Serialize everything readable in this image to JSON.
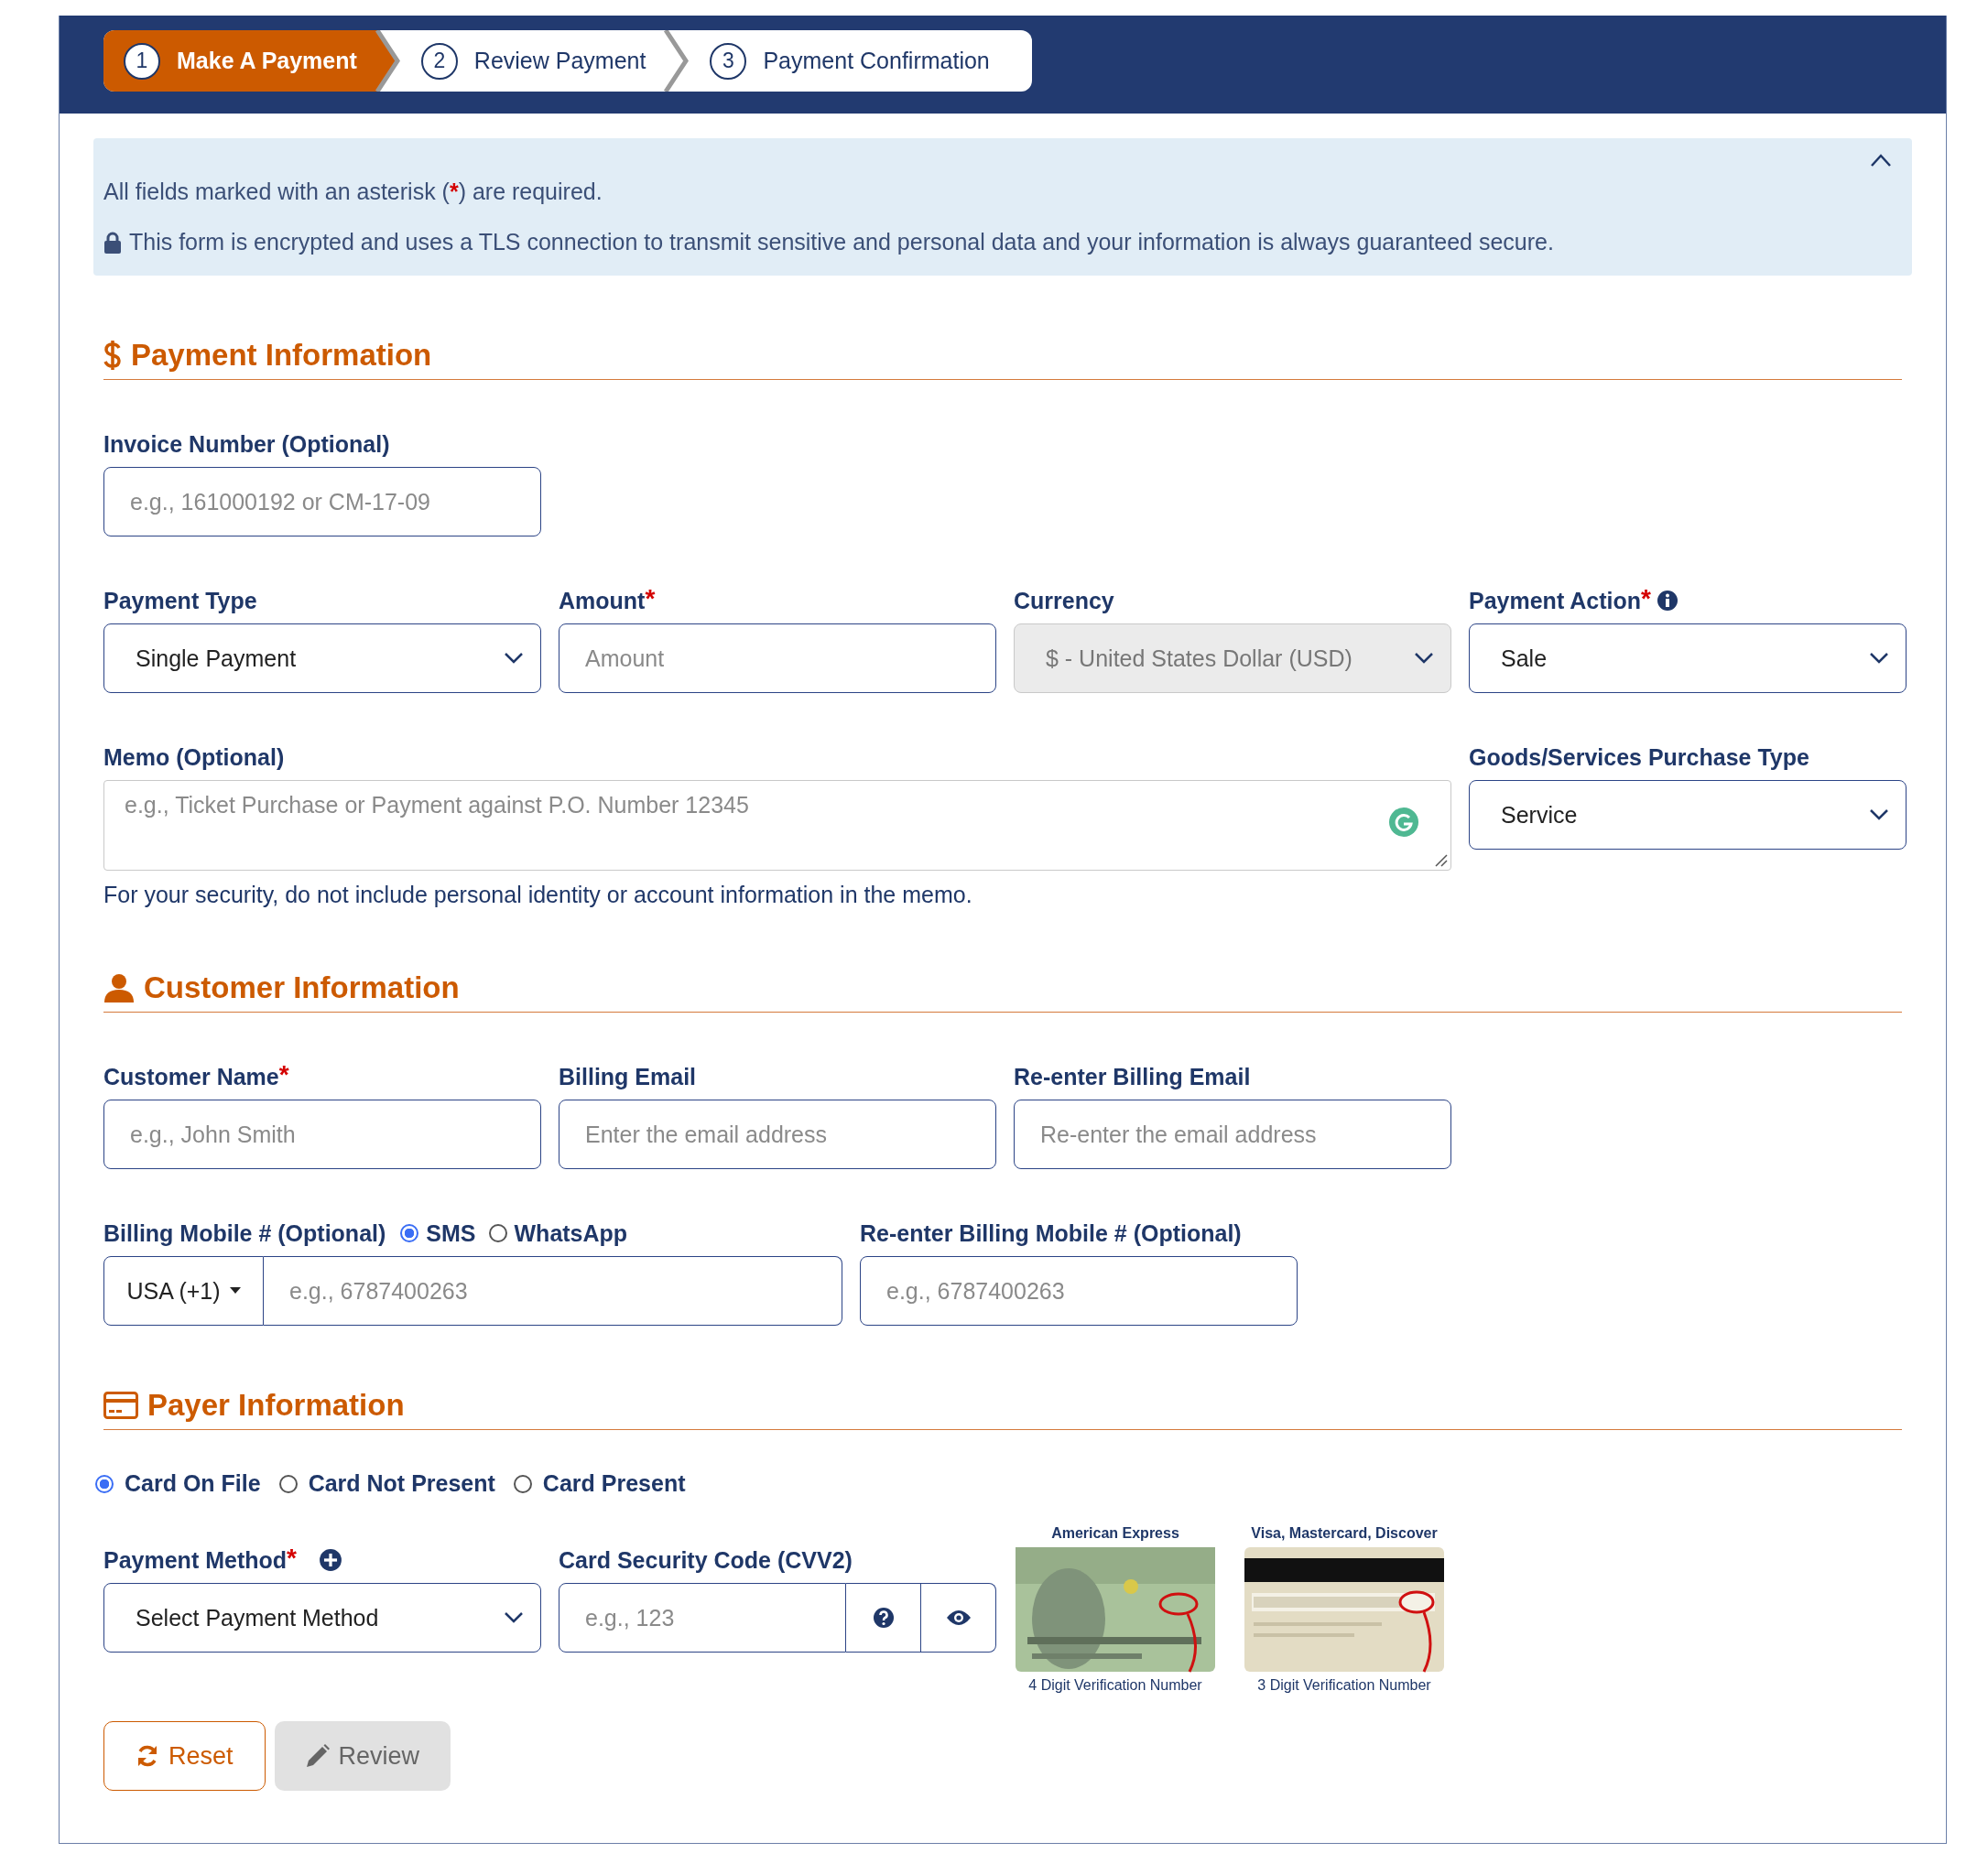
{
  "steps": [
    {
      "number": "1",
      "label": "Make A Payment",
      "selected": true
    },
    {
      "number": "2",
      "label": "Review Payment",
      "selected": false
    },
    {
      "number": "3",
      "label": "Payment Confirmation",
      "selected": false
    }
  ],
  "notice": {
    "expanded": true,
    "required_note": {
      "before": "All fields marked with an asterisk (",
      "mark": "*",
      "after": ") are required."
    },
    "security_note": "This form is encrypted and uses a TLS connection to transmit sensitive and personal data and your information is always guaranteed secure."
  },
  "sections": [
    {
      "kind": "payment",
      "title": "Payment Information",
      "rows": [
        [
          {
            "kind": "text",
            "label": "Invoice Number (Optional)",
            "required": false,
            "placeholder": "e.g., 161000192 or CM-17-09"
          }
        ],
        [
          {
            "kind": "select",
            "label": "Payment Type",
            "required": false,
            "value": "Single Payment",
            "disabled": false
          },
          {
            "kind": "text",
            "label": "Amount",
            "required": true,
            "placeholder": "Amount"
          },
          {
            "kind": "select",
            "label": "Currency",
            "required": false,
            "value": "$ - United States Dollar (USD)",
            "disabled": true
          },
          {
            "kind": "select",
            "label": "Payment Action",
            "required": true,
            "info": true,
            "value": "Sale",
            "disabled": false
          }
        ],
        [
          {
            "kind": "textarea",
            "label": "Memo (Optional)",
            "required": false,
            "placeholder": "e.g., Ticket Purchase or Payment against P.O. Number 12345",
            "hint": "For your security, do not include personal identity or account information in the memo."
          },
          "",
          "",
          {
            "kind": "select",
            "label": "Goods/Services Purchase Type",
            "required": false,
            "value": "Service",
            "disabled": false
          }
        ]
      ]
    },
    {
      "kind": "customer",
      "title": "Customer Information",
      "rows": [
        [
          {
            "kind": "text",
            "label": "Customer Name",
            "required": true,
            "placeholder": "e.g., John Smith"
          },
          {
            "kind": "text",
            "label": "Billing Email",
            "required": false,
            "placeholder": "Enter the email address"
          },
          {
            "kind": "text",
            "label": "Re-enter Billing Email",
            "required": false,
            "placeholder": "Re-enter the email address"
          }
        ],
        [
          {
            "kind": "phone",
            "label": "Billing Mobile # (Optional)",
            "required": false,
            "radios": [
              {
                "label": "SMS",
                "selected": true
              },
              {
                "label": "WhatsApp",
                "selected": false
              }
            ],
            "country": "USA (+1)",
            "placeholder": "e.g., 6787400263"
          },
          "",
          {
            "kind": "text",
            "label": "Re-enter Billing Mobile # (Optional)",
            "required": false,
            "placeholder": "e.g., 6787400263"
          }
        ]
      ]
    },
    {
      "kind": "payer",
      "title": "Payer Information",
      "radios": [
        {
          "label": "Card On File",
          "selected": true
        },
        {
          "label": "Card Not Present",
          "selected": false
        },
        {
          "label": "Card Present",
          "selected": false
        }
      ],
      "rows": [
        [
          {
            "kind": "select",
            "label": "Payment Method",
            "required": true,
            "add": true,
            "value": "Select Payment Method",
            "disabled": false
          },
          {
            "kind": "cvv",
            "label": "Card Security Code (CVV2)",
            "required": false,
            "placeholder": "e.g., 123"
          },
          {
            "kind": "cards",
            "examples": [
              {
                "kind": "front",
                "title": "American Express",
                "caption": "4 Digit Verification Number"
              },
              {
                "kind": "back",
                "title": "Visa, Mastercard, Discover",
                "caption": "3 Digit Verification Number"
              }
            ]
          }
        ]
      ]
    }
  ],
  "buttons": [
    {
      "kind": "reset",
      "label": "Reset",
      "disabled": false
    },
    {
      "kind": "review",
      "label": "Review",
      "disabled": true
    }
  ]
}
